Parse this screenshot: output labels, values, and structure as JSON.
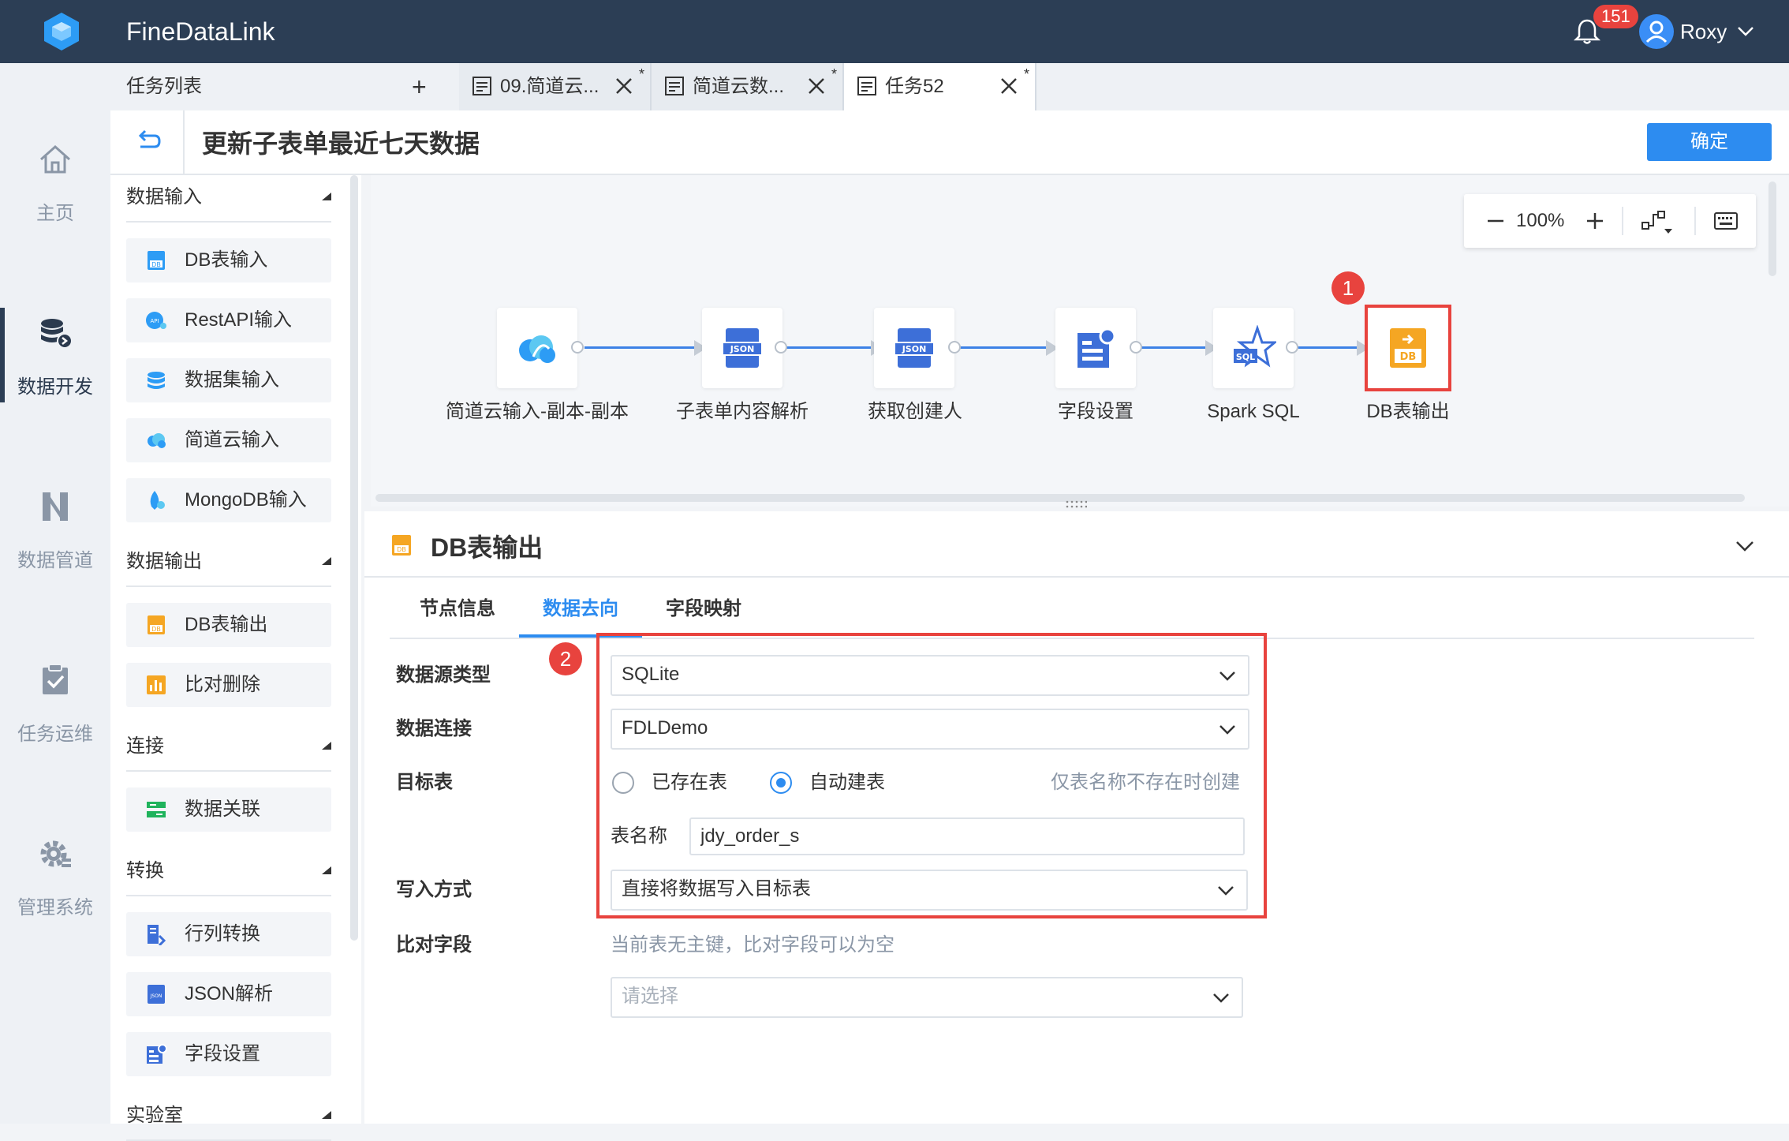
{
  "app": {
    "title": "FineDataLink",
    "notifications": "151",
    "user": "Roxy"
  },
  "leftnav": {
    "items": [
      {
        "label": "主页",
        "icon": "home-icon"
      },
      {
        "label": "数据开发",
        "icon": "database-dev-icon"
      },
      {
        "label": "数据管道",
        "icon": "pipeline-icon"
      },
      {
        "label": "任务运维",
        "icon": "task-check-icon"
      },
      {
        "label": "管理系统",
        "icon": "gear-icon"
      }
    ]
  },
  "tabs": {
    "tasklist_label": "任务列表",
    "add": "+",
    "items": [
      {
        "title": "09.简道云...",
        "modified": "*"
      },
      {
        "title": "简道云数...",
        "modified": "*"
      },
      {
        "title": "任务52",
        "modified": "*"
      }
    ]
  },
  "header": {
    "title": "更新子表单最近七天数据",
    "confirm": "确定"
  },
  "components": {
    "categories": [
      {
        "label": "数据输入",
        "items": [
          "DB表输入",
          "RestAPI输入",
          "数据集输入",
          "简道云输入",
          "MongoDB输入"
        ]
      },
      {
        "label": "数据输出",
        "items": [
          "DB表输出",
          "比对删除"
        ]
      },
      {
        "label": "连接",
        "items": [
          "数据关联"
        ]
      },
      {
        "label": "转换",
        "items": [
          "行列转换",
          "JSON解析",
          "字段设置"
        ]
      },
      {
        "label": "实验室",
        "items": []
      }
    ]
  },
  "canvas": {
    "zoom": "100%",
    "nodes": [
      {
        "label": "简道云输入-副本-副本",
        "icon": "jdy-cloud-icon"
      },
      {
        "label": "子表单内容解析",
        "icon": "json-icon"
      },
      {
        "label": "获取创建人",
        "icon": "json-icon"
      },
      {
        "label": "字段设置",
        "icon": "field-settings-icon"
      },
      {
        "label": "Spark SQL",
        "icon": "spark-sql-icon"
      },
      {
        "label": "DB表输出",
        "icon": "db-output-icon"
      }
    ],
    "markers": [
      "1",
      "2"
    ]
  },
  "props": {
    "title": "DB表输出",
    "tabs": [
      "节点信息",
      "数据去向",
      "字段映射"
    ],
    "active_tab": 1,
    "fields": {
      "source_type": {
        "label": "数据源类型",
        "value": "SQLite"
      },
      "connection": {
        "label": "数据连接",
        "value": "FDLDemo"
      },
      "target": {
        "label": "目标表",
        "opt_existing": "已存在表",
        "opt_auto": "自动建表",
        "selected": "自动建表",
        "hint": "仅表名称不存在时创建",
        "table_name_label": "表名称",
        "table_name_value": "jdy_order_s"
      },
      "write_mode": {
        "label": "写入方式",
        "value": "直接将数据写入目标表"
      },
      "compare": {
        "label": "比对字段",
        "hint": "当前表无主键，比对字段可以为空",
        "placeholder": "请选择"
      }
    }
  },
  "colors": {
    "topbar": "#2c3e55",
    "accent": "#2d8cf0",
    "highlight": "#e8433e"
  }
}
